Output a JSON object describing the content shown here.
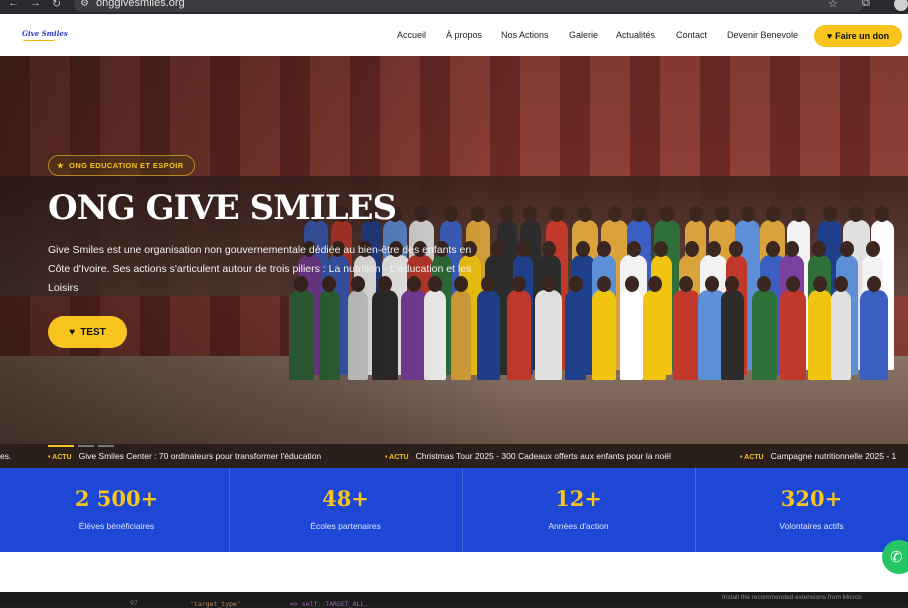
{
  "browser": {
    "back": "←",
    "forward": "→",
    "reload": "↻",
    "url": "onggivesmiles.org"
  },
  "header": {
    "logo_text": "Give Smiles",
    "nav": [
      "Accueil",
      "À propos",
      "Nos Actions",
      "Galerie",
      "Actualités",
      "Contact",
      "Devenir Benevole"
    ],
    "donate_label": "Faire un don"
  },
  "hero": {
    "badge": "ONG EDUCATION ET ESPOIR",
    "title": "ONG GIVE SMILES",
    "description": "Give Smiles est une organisation non gouvernementale dédiée au bien-être des enfants en Côte d'Ivoire. Ses actions s'articulent autour de trois piliers : La nutrition - L'éducation et les Loisirs",
    "cta": "TEST"
  },
  "ticker": {
    "items": [
      {
        "tag": "",
        "text": "es."
      },
      {
        "tag": "• ACTU",
        "text": "Give Smiles Center : 70 ordinateurs pour transformer l'éducation"
      },
      {
        "tag": "• ACTU",
        "text": "Christmas Tour 2025 - 300 Cadeaux offerts aux enfants pour la noël"
      },
      {
        "tag": "• ACTU",
        "text": "Campagne nutritionnelle 2025 - 1"
      }
    ]
  },
  "stats": [
    {
      "value": "2 500+",
      "label": "Élèves bénéficiaires"
    },
    {
      "value": "48+",
      "label": "Écoles partenaires"
    },
    {
      "value": "12+",
      "label": "Années d'action"
    },
    {
      "value": "320+",
      "label": "Volontaires actifs"
    }
  ],
  "colors": {
    "accent": "#f7c51e",
    "stats_bg": "#1e47d6",
    "whatsapp": "#25c565"
  },
  "ide_strip": {
    "line_no": "97",
    "code_key": "'target_type'",
    "code_val": "=> self::TARGET_ALL,",
    "notice": "Install the recommended extensions from Micros"
  }
}
